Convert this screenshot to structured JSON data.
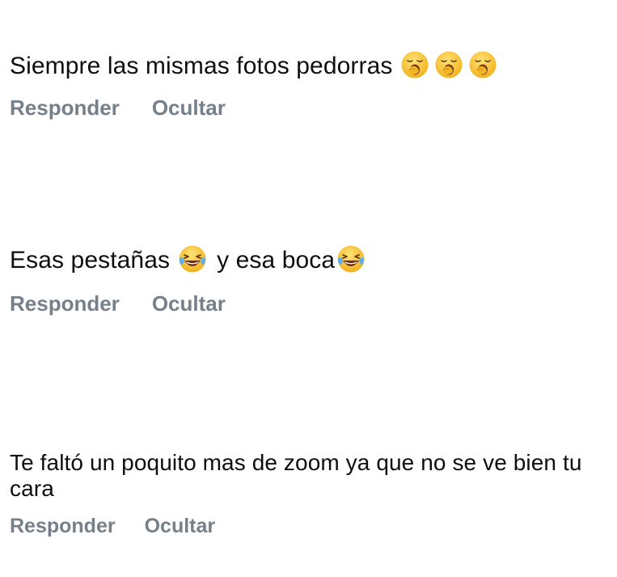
{
  "comments": [
    {
      "text": "Siempre las mismas fotos pedorras",
      "emojis": [
        "yawning-face-icon",
        "yawning-face-icon",
        "yawning-face-icon"
      ],
      "reply_label": "Responder",
      "hide_label": "Ocultar"
    },
    {
      "text_part1": "Esas pestañas",
      "text_part2": "y esa boca",
      "emojis": [
        "laughing-tears-face-icon",
        "laughing-tears-face-icon"
      ],
      "reply_label": "Responder",
      "hide_label": "Ocultar"
    },
    {
      "text": "Te faltó un poquito mas de zoom ya que no se ve bien tu cara",
      "reply_label": "Responder",
      "hide_label": "Ocultar"
    }
  ],
  "colors": {
    "text": "#0f0f0f",
    "action_text": "#75808a",
    "emoji_face": "#f7c53b",
    "emoji_tear": "#5ab0f0"
  }
}
